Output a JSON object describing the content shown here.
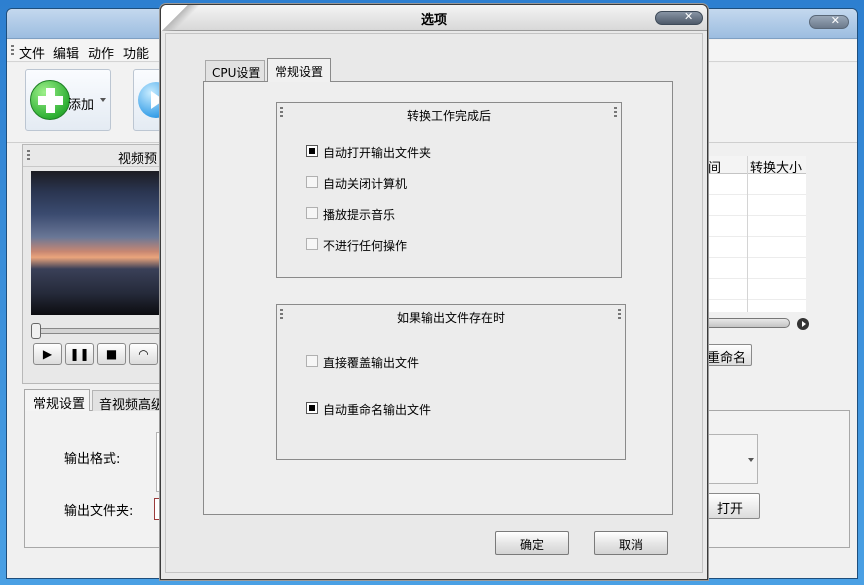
{
  "main_window": {
    "menu": [
      "文件",
      "编辑",
      "动作",
      "功能"
    ],
    "toolbar": {
      "add_label": "添加"
    },
    "preview": {
      "title": "视频预"
    },
    "bottom_tabs": [
      "常规设置",
      "音视频高级"
    ],
    "output_format_label": "输出格式:",
    "output_folder_label": "输出文件夹:",
    "list_columns": [
      "间",
      "转换大小"
    ],
    "rename_button": "重命名",
    "open_button": "打开",
    "playback_controls": [
      "play-icon",
      "pause-icon",
      "stop-icon",
      "headphones-icon"
    ]
  },
  "dialog": {
    "title": "选项",
    "close_glyph": "✕",
    "tabs": [
      {
        "label": "CPU设置",
        "active": false
      },
      {
        "label": "常规设置",
        "active": true
      }
    ],
    "after_conversion": {
      "title": "转换工作完成后",
      "options": [
        {
          "label": "自动打开输出文件夹",
          "checked": true
        },
        {
          "label": "自动关闭计算机",
          "checked": false
        },
        {
          "label": "播放提示音乐",
          "checked": false
        },
        {
          "label": "不进行任何操作",
          "checked": false
        }
      ]
    },
    "if_output_exists": {
      "title": "如果输出文件存在时",
      "options": [
        {
          "label": "直接覆盖输出文件",
          "checked": false
        },
        {
          "label": "自动重命名输出文件",
          "checked": true
        }
      ]
    },
    "ok_button": "确定",
    "cancel_button": "取消"
  }
}
